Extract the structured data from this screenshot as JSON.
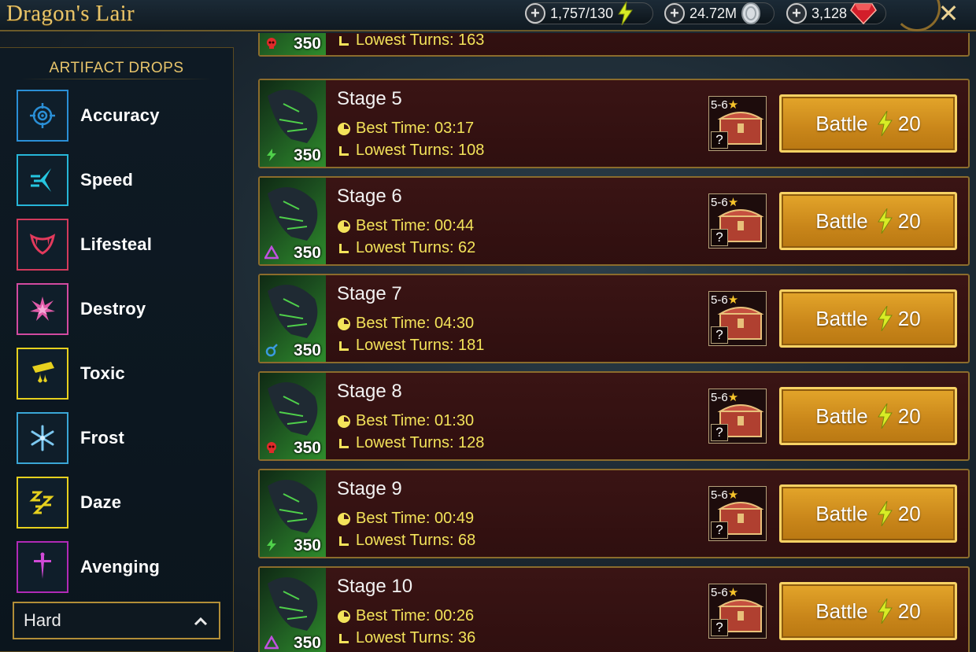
{
  "header": {
    "title": "Dragon's Lair",
    "energy": "1,757/130",
    "silver": "24.72M",
    "gems": "3,128",
    "close_label": "✕"
  },
  "sidebar": {
    "title": "ARTIFACT DROPS",
    "items": [
      {
        "label": "Accuracy",
        "icon": "target-icon",
        "color": "#2a8fd6"
      },
      {
        "label": "Speed",
        "icon": "speed-arrow-icon",
        "color": "#26b6d8"
      },
      {
        "label": "Lifesteal",
        "icon": "fangs-icon",
        "color": "#d23a5c"
      },
      {
        "label": "Destroy",
        "icon": "burst-icon",
        "color": "#d24aa0"
      },
      {
        "label": "Toxic",
        "icon": "poison-drip-icon",
        "color": "#e6d01e"
      },
      {
        "label": "Frost",
        "icon": "snowflake-icon",
        "color": "#3aa6d6"
      },
      {
        "label": "Daze",
        "icon": "zzz-icon",
        "color": "#e6d01e"
      },
      {
        "label": "Avenging",
        "icon": "sword-icon",
        "color": "#b02ab6"
      }
    ],
    "difficulty": "Hard"
  },
  "stages": [
    {
      "name": "",
      "best_time": "",
      "lowest_turns": "Lowest Turns: 163",
      "level": "350",
      "affinity": "force",
      "stars": "",
      "battle_label": "",
      "energy_cost": ""
    },
    {
      "name": "Stage 5",
      "best_time": "Best Time: 03:17",
      "lowest_turns": "Lowest Turns: 108",
      "level": "350",
      "affinity": "magic",
      "stars": "5-6",
      "battle_label": "Battle",
      "energy_cost": "20"
    },
    {
      "name": "Stage 6",
      "best_time": "Best Time: 00:44",
      "lowest_turns": "Lowest Turns: 62",
      "level": "350",
      "affinity": "void",
      "stars": "5-6",
      "battle_label": "Battle",
      "energy_cost": "20"
    },
    {
      "name": "Stage 7",
      "best_time": "Best Time: 04:30",
      "lowest_turns": "Lowest Turns: 181",
      "level": "350",
      "affinity": "spirit",
      "stars": "5-6",
      "battle_label": "Battle",
      "energy_cost": "20"
    },
    {
      "name": "Stage 8",
      "best_time": "Best Time: 01:30",
      "lowest_turns": "Lowest Turns: 128",
      "level": "350",
      "affinity": "force",
      "stars": "5-6",
      "battle_label": "Battle",
      "energy_cost": "20"
    },
    {
      "name": "Stage 9",
      "best_time": "Best Time: 00:49",
      "lowest_turns": "Lowest Turns: 68",
      "level": "350",
      "affinity": "magic",
      "stars": "5-6",
      "battle_label": "Battle",
      "energy_cost": "20"
    },
    {
      "name": "Stage 10",
      "best_time": "Best Time: 00:26",
      "lowest_turns": "Lowest Turns: 36",
      "level": "350",
      "affinity": "void",
      "stars": "5-6",
      "battle_label": "Battle",
      "energy_cost": "20"
    }
  ]
}
